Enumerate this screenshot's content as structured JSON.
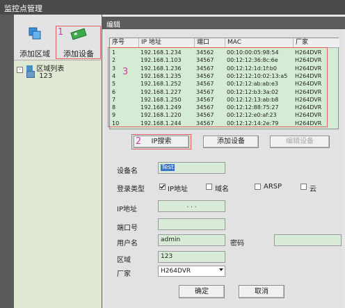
{
  "window": {
    "title": "监控点管理"
  },
  "toolbar": {
    "add_area_label": "添加区域",
    "add_device_label": "添加设备"
  },
  "tree": {
    "root_label": "区域列表",
    "child_label": "123"
  },
  "edit_title": "编辑",
  "table": {
    "headers": [
      "序号",
      "IP 地址",
      "端口",
      "MAC",
      "厂家"
    ],
    "rows": [
      [
        "1",
        "192.168.1.234",
        "34562",
        "00:10:00:05:98:54",
        "H264DVR"
      ],
      [
        "2",
        "192.168.1.103",
        "34567",
        "00:12:12:36:8c:6e",
        "H264DVR"
      ],
      [
        "3",
        "192.168.1.236",
        "34567",
        "00:12:12:1d:1f:b0",
        "H264DVR"
      ],
      [
        "4",
        "192.168.1.235",
        "34567",
        "00:12:12:10:02:13:a5",
        "H264DVR"
      ],
      [
        "5",
        "192.168.1.252",
        "34567",
        "00:12:12:ab:ab:e3",
        "H264DVR"
      ],
      [
        "6",
        "192.168.1.227",
        "34567",
        "00:12:12:b3:3a:02",
        "H264DVR"
      ],
      [
        "7",
        "192.168.1.250",
        "34567",
        "00:12:12:13:ab:b8",
        "H264DVR"
      ],
      [
        "8",
        "192.168.1.249",
        "34567",
        "00:12:12:88:75:27",
        "H264DVR"
      ],
      [
        "9",
        "192.168.1.220",
        "34567",
        "00:12:12:e0:af:23",
        "H264DVR"
      ],
      [
        "10",
        "192.168.1.244",
        "34567",
        "00:12:12:14:2e:79",
        "H264DVR"
      ]
    ]
  },
  "buttons": {
    "ip_search": "IP搜索",
    "add_device": "添加设备",
    "edit_device": "编辑设备",
    "ok": "确定",
    "cancel": "取消"
  },
  "form": {
    "device_name_label": "设备名",
    "device_name_value": "Test",
    "login_type_label": "登录类型",
    "opt_ip": "IP地址",
    "opt_domain": "域名",
    "opt_arsp": "ARSP",
    "opt_cloud": "云",
    "ip_label": "IP地址",
    "ip_value": ".   .   .",
    "port_label": "端口号",
    "user_label": "用户名",
    "user_value": "admin",
    "password_label": "密码",
    "area_label": "区域",
    "area_value": "123",
    "vendor_label": "厂家",
    "vendor_value": "H264DVR"
  },
  "annotations": {
    "m1": "1",
    "m2": "2",
    "m3": "3"
  }
}
